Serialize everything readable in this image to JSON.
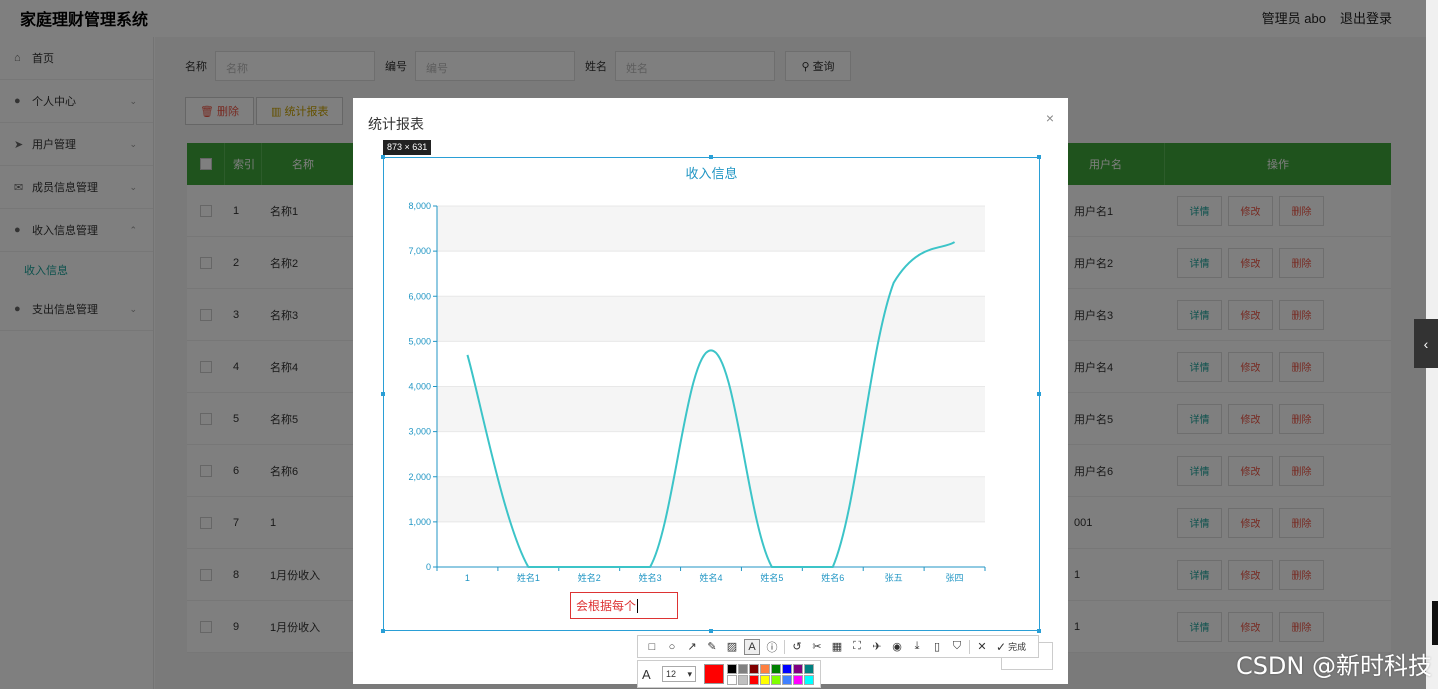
{
  "app": {
    "title": "家庭理财管理系统",
    "user": "管理员 abo",
    "logout": "退出登录"
  },
  "sidebar": {
    "items": [
      {
        "label": "首页",
        "icon": "home-icon"
      },
      {
        "label": "个人中心",
        "icon": "user-icon"
      },
      {
        "label": "用户管理",
        "icon": "send-icon"
      },
      {
        "label": "成员信息管理",
        "icon": "mail-icon"
      },
      {
        "label": "收入信息管理",
        "icon": "user-icon"
      },
      {
        "label": "收入信息",
        "icon": ""
      },
      {
        "label": "支出信息管理",
        "icon": "user-icon"
      }
    ]
  },
  "search": {
    "name_label": "名称",
    "name_placeholder": "名称",
    "code_label": "编号",
    "code_placeholder": "编号",
    "person_label": "姓名",
    "person_placeholder": "姓名",
    "query_button": "查询"
  },
  "actions": {
    "delete": "删除",
    "stats": "统计报表"
  },
  "table": {
    "headers": [
      "索引",
      "名称",
      "用户名",
      "操作"
    ],
    "ops": {
      "detail": "详情",
      "edit": "修改",
      "delete": "删除"
    },
    "rows": [
      {
        "idx": "1",
        "name": "名称1",
        "user": "用户名1"
      },
      {
        "idx": "2",
        "name": "名称2",
        "user": "用户名2"
      },
      {
        "idx": "3",
        "name": "名称3",
        "user": "用户名3"
      },
      {
        "idx": "4",
        "name": "名称4",
        "user": "用户名4"
      },
      {
        "idx": "5",
        "name": "名称5",
        "user": "用户名5"
      },
      {
        "idx": "6",
        "name": "名称6",
        "user": "用户名6"
      },
      {
        "idx": "7",
        "name": "1",
        "user": "001"
      },
      {
        "idx": "8",
        "name": "1月份收入",
        "user": "1"
      },
      {
        "idx": "9",
        "name": "1月份收入",
        "user": "1"
      }
    ]
  },
  "modal": {
    "title": "统计报表",
    "close": "×"
  },
  "screenshot": {
    "size_label": "873 × 631",
    "annotation_text": "会根据每个",
    "font_size": "12",
    "done_label": "完成",
    "current_color": "#ff0000",
    "palette": [
      "#000000",
      "#808080",
      "#800000",
      "#ff8040",
      "#008000",
      "#0000ff",
      "#800080",
      "#008080",
      "#ffffff",
      "#c0c0c0",
      "#ff0000",
      "#ffff00",
      "#80ff00",
      "#4080ff",
      "#ff00ff",
      "#00ffff"
    ]
  },
  "watermark": "CSDN @新时科技",
  "chart_data": {
    "type": "line",
    "title": "收入信息",
    "categories": [
      "1",
      "姓名1",
      "姓名2",
      "姓名3",
      "姓名4",
      "姓名5",
      "姓名6",
      "张五",
      "张四"
    ],
    "values": [
      4700,
      0,
      0,
      0,
      4800,
      0,
      0,
      6300,
      7200
    ],
    "ylim": [
      0,
      8000
    ],
    "yticks": [
      "0",
      "1,000",
      "2,000",
      "3,000",
      "4,000",
      "5,000",
      "6,000",
      "7,000",
      "8,000"
    ],
    "smooth": true,
    "line_color": "#3cc4c8",
    "axis_color": "#2196c4",
    "grid_bands": true
  }
}
